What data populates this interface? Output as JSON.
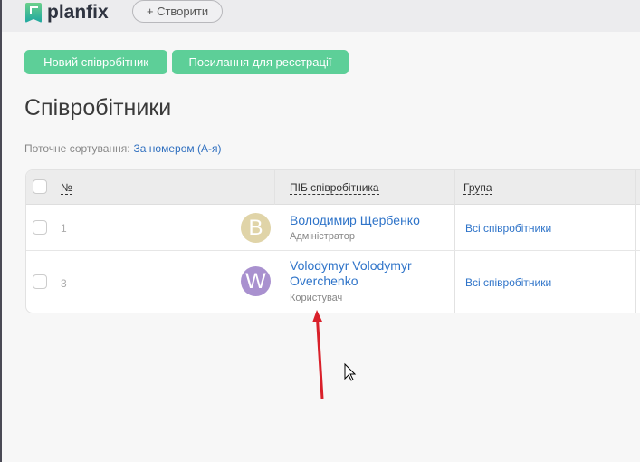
{
  "header": {
    "logo_text": "planfix",
    "create_label": "+ Створити"
  },
  "toolbar": {
    "new_employee": "Новий співробітник",
    "registration_link": "Посилання для реєстрації"
  },
  "page_title": "Співробітники",
  "sort": {
    "label": "Поточне сортування:",
    "value": "За номером (А-я)"
  },
  "table": {
    "columns": [
      "№",
      "ПІБ співробітника",
      "Група"
    ],
    "rows": [
      {
        "num": "1",
        "avatar": "В",
        "avatar_color": "#e0d4a8",
        "name": "Володимир Щербенко",
        "role": "Адміністратор",
        "group": "Всі співробітники"
      },
      {
        "num": "3",
        "avatar": "W",
        "avatar_color": "#a991cf",
        "name": "Volodymyr Volodymyr Overchenko",
        "role": "Користувач",
        "group": "Всі співробітники"
      }
    ]
  },
  "annotation_color": "#d9202a"
}
